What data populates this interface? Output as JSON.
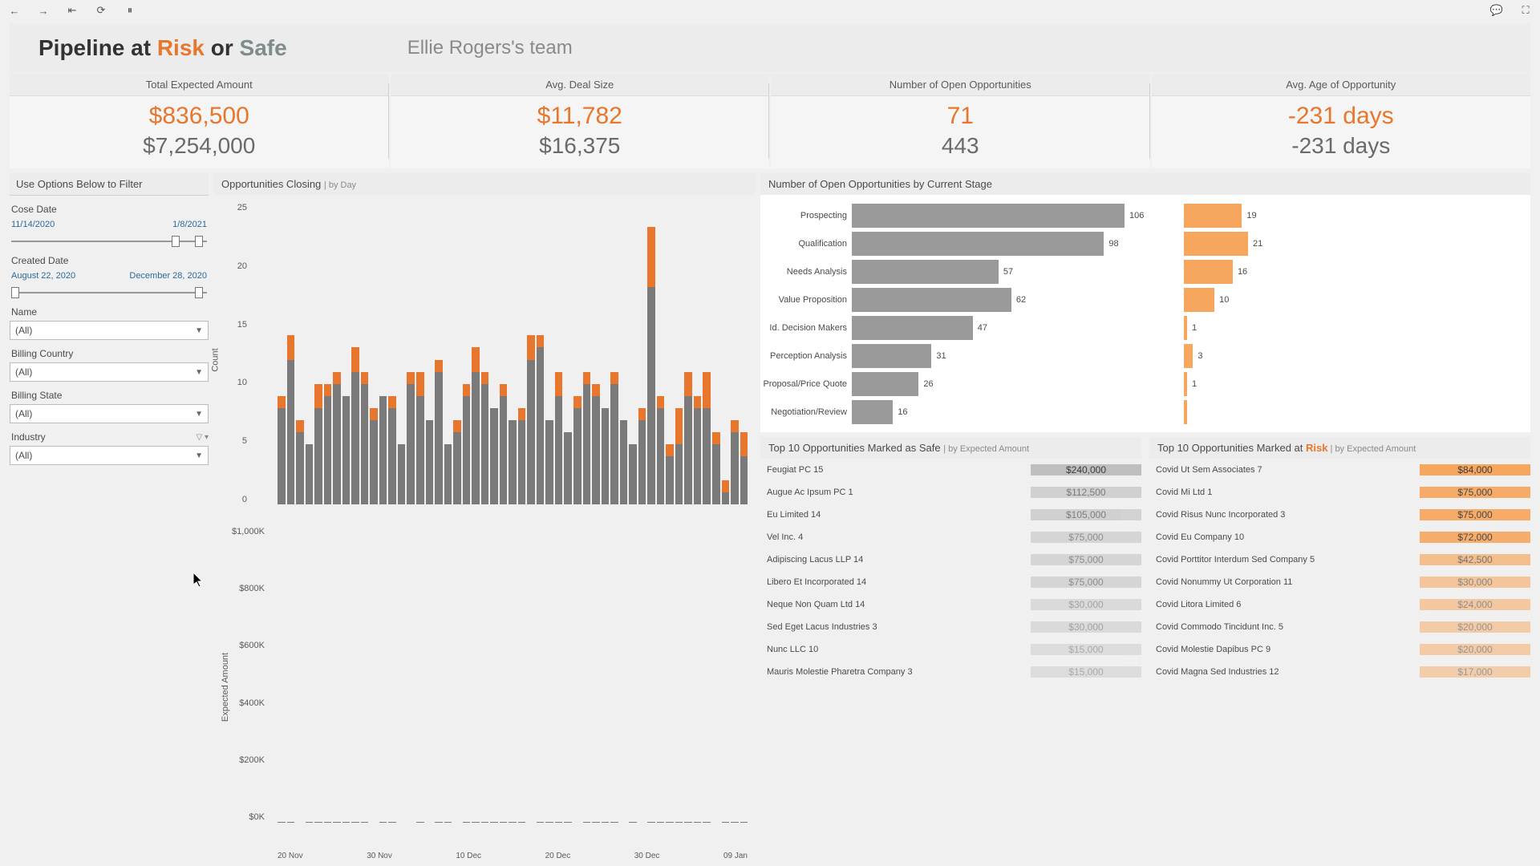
{
  "header": {
    "title_prefix": "Pipeline at ",
    "title_risk": "Risk",
    "title_or": " or ",
    "title_safe": "Safe",
    "subtitle": "Ellie Rogers's team"
  },
  "kpi": [
    {
      "label": "Total Expected Amount",
      "primary": "$836,500",
      "secondary": "$7,254,000"
    },
    {
      "label": "Avg. Deal Size",
      "primary": "$11,782",
      "secondary": "$16,375"
    },
    {
      "label": "Number of Open Opportunities",
      "primary": "71",
      "secondary": "443"
    },
    {
      "label": "Avg. Age of Opportunity",
      "primary": "-231 days",
      "secondary": "-231 days"
    }
  ],
  "filters": {
    "panel_title": "Use Options Below to Filter",
    "close_date": {
      "label": "Cose Date",
      "from": "11/14/2020",
      "to": "1/8/2021",
      "low_pct": 84,
      "high_pct": 96
    },
    "created_date": {
      "label": "Created Date",
      "from": "August 22, 2020",
      "to": "December 28, 2020",
      "low_pct": 2,
      "high_pct": 96
    },
    "name": {
      "label": "Name",
      "value": "(All)"
    },
    "billing_country": {
      "label": "Billing Country",
      "value": "(All)"
    },
    "billing_state": {
      "label": "Billing State",
      "value": "(All)"
    },
    "industry": {
      "label": "Industry",
      "value": "(All)"
    }
  },
  "chart_closing": {
    "title": "Opportunities Closing ",
    "sub": "| by Day",
    "yaxis_label": "Count",
    "yaxis_label2": "Expected Amount",
    "y_ticks_count": [
      "25",
      "20",
      "15",
      "10",
      "5",
      "0"
    ],
    "y_ticks_amount": [
      "$1,000K",
      "$800K",
      "$600K",
      "$400K",
      "$200K",
      "$0K"
    ],
    "x_ticks": [
      "20 Nov",
      "30 Nov",
      "10 Dec",
      "20 Dec",
      "30 Dec",
      "09 Jan"
    ]
  },
  "stages": {
    "title": "Number of Open Opportunities by Current Stage"
  },
  "top10_safe": {
    "title_prefix": "Top 10 Opportunities Marked as Safe ",
    "sub": "| by Expected Amount"
  },
  "top10_risk": {
    "title_prefix": "Top 10 Opportunities Marked at ",
    "title_em": "Risk",
    "sub": " | by Expected Amount"
  },
  "chart_data": [
    {
      "type": "bar",
      "title": "Opportunities Closing | by Day (Count)",
      "ylabel": "Count",
      "ylim": [
        0,
        25
      ],
      "x_range": [
        "2020-11-14",
        "2021-01-09"
      ],
      "series": [
        {
          "name": "Safe",
          "color": "#7a7a7a",
          "values": [
            8,
            12,
            6,
            5,
            8,
            9,
            10,
            9,
            11,
            10,
            7,
            9,
            8,
            5,
            10,
            9,
            7,
            11,
            5,
            6,
            9,
            11,
            10,
            8,
            9,
            7,
            7,
            12,
            13,
            7,
            9,
            6,
            8,
            10,
            9,
            8,
            10,
            7,
            5,
            7,
            18,
            8,
            4,
            5,
            9,
            8,
            8,
            5,
            1,
            6,
            4
          ]
        },
        {
          "name": "Risk",
          "color": "#e8762d",
          "values": [
            1,
            2,
            1,
            0,
            2,
            1,
            1,
            0,
            2,
            1,
            1,
            0,
            1,
            0,
            1,
            2,
            0,
            1,
            0,
            1,
            1,
            2,
            1,
            0,
            1,
            0,
            1,
            2,
            1,
            0,
            2,
            0,
            1,
            1,
            1,
            0,
            1,
            0,
            0,
            1,
            5,
            1,
            1,
            3,
            2,
            1,
            3,
            1,
            1,
            1,
            2
          ]
        }
      ]
    },
    {
      "type": "bar",
      "title": "Opportunities Closing | by Day (Expected Amount)",
      "ylabel": "Expected Amount",
      "ylim": [
        0,
        1000000
      ],
      "x_range": [
        "2020-11-14",
        "2021-01-09"
      ],
      "series": [
        {
          "name": "Safe",
          "color": "#7a7a7a",
          "values": [
            250,
            600,
            100,
            550,
            580,
            280,
            320,
            480,
            280,
            550,
            150,
            380,
            260,
            180,
            140,
            530,
            140,
            480,
            520,
            100,
            320,
            580,
            440,
            560,
            380,
            360,
            540,
            120,
            400,
            800,
            740,
            580,
            120,
            480,
            320,
            240,
            560,
            120,
            380,
            200,
            820,
            580,
            540,
            580,
            240,
            600,
            560,
            180,
            320,
            520,
            960
          ]
        },
        {
          "name": "Risk",
          "color": "#e8762d",
          "values": [
            40,
            30,
            0,
            60,
            40,
            30,
            0,
            60,
            40,
            0,
            10,
            40,
            20,
            30,
            0,
            50,
            10,
            60,
            50,
            0,
            30,
            50,
            30,
            40,
            20,
            10,
            60,
            10,
            30,
            60,
            120,
            50,
            0,
            50,
            30,
            20,
            50,
            10,
            20,
            20,
            120,
            30,
            70,
            60,
            20,
            60,
            60,
            20,
            20,
            40,
            80
          ]
        }
      ]
    },
    {
      "type": "bar",
      "title": "Number of Open Opportunities by Current Stage",
      "orientation": "horizontal",
      "categories": [
        "Prospecting",
        "Qualification",
        "Needs Analysis",
        "Value Proposition",
        "Id. Decision Makers",
        "Perception Analysis",
        "Proposal/Price Quote",
        "Negotiation/Review"
      ],
      "series": [
        {
          "name": "Safe",
          "color": "#9a9a9a",
          "values": [
            106,
            98,
            57,
            62,
            47,
            31,
            26,
            16
          ]
        },
        {
          "name": "Risk",
          "color": "#f7a65e",
          "values": [
            19,
            21,
            16,
            10,
            1,
            3,
            1,
            0
          ]
        }
      ]
    },
    {
      "type": "table",
      "title": "Top 10 Opportunities Marked as Safe | by Expected Amount",
      "rows": [
        [
          "Feugiat PC 15",
          "$240,000"
        ],
        [
          "Augue Ac Ipsum PC 1",
          "$112,500"
        ],
        [
          "Eu Limited 14",
          "$105,000"
        ],
        [
          "Vel Inc. 4",
          "$75,000"
        ],
        [
          "Adipiscing Lacus LLP 14",
          "$75,000"
        ],
        [
          "Libero Et Incorporated 14",
          "$75,000"
        ],
        [
          "Neque Non Quam Ltd 14",
          "$30,000"
        ],
        [
          "Sed Eget Lacus Industries 3",
          "$30,000"
        ],
        [
          "Nunc LLC 10",
          "$15,000"
        ],
        [
          "Mauris Molestie Pharetra Company 3",
          "$15,000"
        ]
      ]
    },
    {
      "type": "table",
      "title": "Top 10 Opportunities Marked at Risk | by Expected Amount",
      "rows": [
        [
          "Covid Ut Sem Associates 7",
          "$84,000"
        ],
        [
          "Covid Mi Ltd 1",
          "$75,000"
        ],
        [
          "Covid Risus Nunc Incorporated 3",
          "$75,000"
        ],
        [
          "Covid Eu Company 10",
          "$72,000"
        ],
        [
          "Covid Porttitor Interdum Sed Company 5",
          "$42,500"
        ],
        [
          "Covid Nonummy Ut Corporation 11",
          "$30,000"
        ],
        [
          "Covid Litora Limited 6",
          "$24,000"
        ],
        [
          "Covid Commodo Tincidunt Inc. 5",
          "$20,000"
        ],
        [
          "Covid Molestie Dapibus PC 9",
          "$20,000"
        ],
        [
          "Covid Magna Sed Industries 12",
          "$17,000"
        ]
      ]
    }
  ]
}
